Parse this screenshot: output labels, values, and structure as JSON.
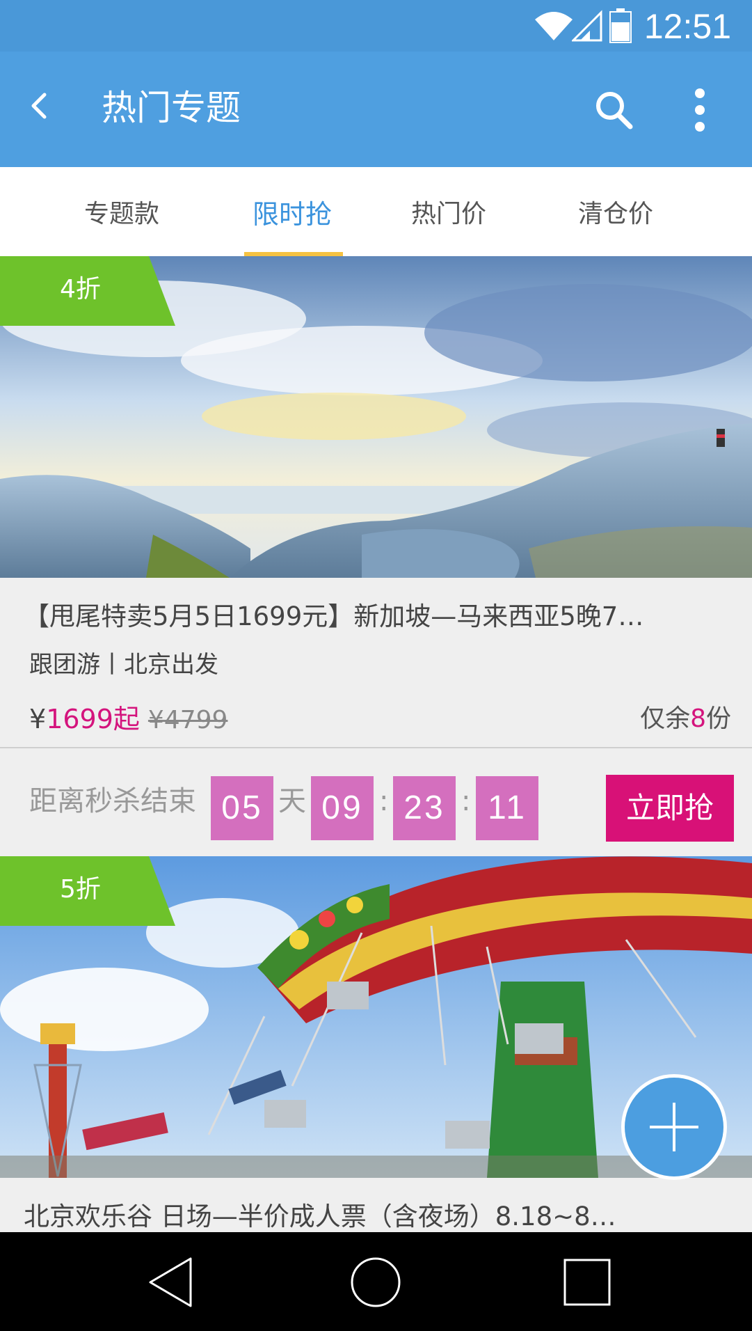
{
  "status_bar": {
    "time": "12:51",
    "icons": [
      "wifi-icon",
      "signal-icon",
      "battery-icon"
    ]
  },
  "toolbar": {
    "title": "热门专题",
    "icons": [
      "back-icon",
      "search-icon",
      "more-vert-icon"
    ]
  },
  "tabs": [
    {
      "label": "专题款",
      "active": false
    },
    {
      "label": "限时抢",
      "active": true
    },
    {
      "label": "热门价",
      "active": false
    },
    {
      "label": "清仓价",
      "active": false
    }
  ],
  "cards": [
    {
      "discount": "4折",
      "image": "coastal-rocks-landscape",
      "title": "【甩尾特卖5月5日1699元】新加坡—马来西亚5晚7…",
      "subtitle": "跟团游丨北京出发",
      "price_symbol": "¥",
      "price_now": "1699起",
      "price_old": "¥4799",
      "stock_prefix": "仅余",
      "stock_num": "8",
      "stock_suffix": "份",
      "countdown": {
        "label": "距离秒杀结束",
        "days": "05",
        "day_unit": "天",
        "hours": "09",
        "minutes": "23",
        "seconds": "11",
        "separator": ":"
      },
      "buy_label": "立即抢"
    },
    {
      "discount": "5折",
      "image": "amusement-park-swing-ride",
      "title": "北京欢乐谷  日场—半价成人票（含夜场）8.18~8…"
    }
  ],
  "fab": {
    "icon": "plus-icon"
  },
  "nav_bar": {
    "icons": [
      "nav-back-icon",
      "nav-home-icon",
      "nav-recent-icon"
    ]
  },
  "colors": {
    "status_bar": "#4a98d8",
    "toolbar": "#4f9fe0",
    "tab_active": "#3b93dd",
    "tab_underline": "#f6c242",
    "discount_flag": "#6ec22b",
    "price": "#d4147d",
    "countdown_box": "#d46fbe",
    "buy_button": "#d81177",
    "fab": "#4c9ee0"
  }
}
